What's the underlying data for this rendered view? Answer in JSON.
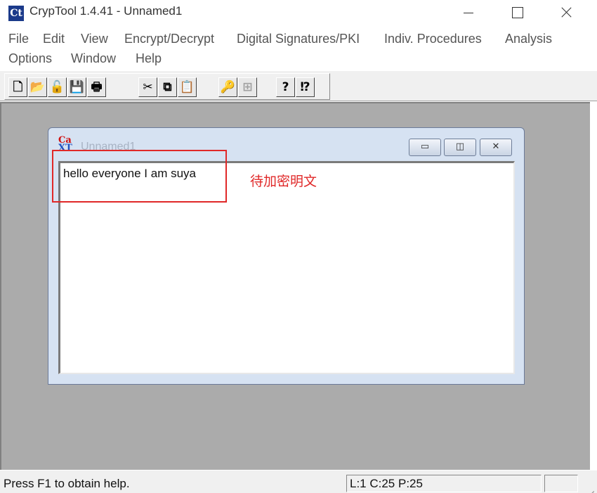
{
  "window": {
    "title": "CrypTool 1.4.41 - Unnamed1",
    "icon": "ct-app-icon"
  },
  "menu": [
    "File",
    "Edit",
    "View",
    "Encrypt/Decrypt",
    "Digital Signatures/PKI",
    "Indiv. Procedures",
    "Analysis",
    "Options",
    "Window",
    "Help"
  ],
  "toolbar": {
    "new": "🗋",
    "open": "📂",
    "open_alt": "🔓",
    "save": "💾",
    "print": "🖶",
    "cut": "✂",
    "copy": "⧉",
    "paste": "📋",
    "key": "🔑",
    "props": "⊞",
    "help": "?",
    "context_help": "⁉"
  },
  "child": {
    "title": "Unnamed1",
    "icon_top": "Ca",
    "icon_bottom": "XT",
    "min": "▭",
    "max": "◫",
    "close": "✕"
  },
  "editor": {
    "content": "hello everyone I am suya"
  },
  "annotation": {
    "label": "待加密明文",
    "color": "#e02828"
  },
  "status": {
    "help": "Press F1 to obtain help.",
    "position": "L:1   C:25   P:25"
  }
}
